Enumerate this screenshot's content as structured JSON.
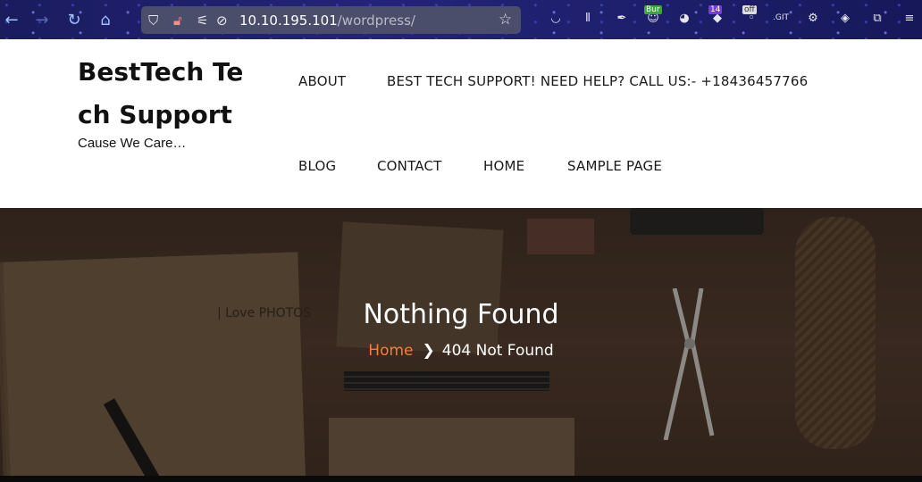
{
  "browser": {
    "url_host": "10.10.195.101",
    "url_path": "/wordpress/",
    "icons": {
      "back": "arrow-left-icon",
      "forward": "arrow-right-icon",
      "reload": "reload-icon",
      "home": "home-icon",
      "shield": "shield-icon",
      "lock": "lock-icon",
      "star": "star-icon"
    },
    "extensions": [
      {
        "name": "pocket-icon",
        "glyph": "◡"
      },
      {
        "name": "library-icon",
        "glyph": "⫴"
      },
      {
        "name": "feather-icon",
        "glyph": "✒"
      },
      {
        "name": "burp-extension-icon",
        "badge": "Bur",
        "glyph": "☺"
      },
      {
        "name": "cookie-icon",
        "glyph": "◕"
      },
      {
        "name": "extension-14-icon",
        "badge": "14",
        "glyph": "◆"
      },
      {
        "name": "extension-off-icon",
        "badge": "off",
        "glyph": "◦"
      },
      {
        "name": "git-extension-icon",
        "glyph": ".GIT"
      },
      {
        "name": "gear-extension-icon",
        "glyph": "⚙"
      },
      {
        "name": "wappalyzer-icon",
        "glyph": "◈"
      },
      {
        "name": "extensions-puzzle-icon",
        "glyph": "⧉"
      },
      {
        "name": "menu-icon",
        "glyph": "≡"
      }
    ]
  },
  "site": {
    "title": "BestTech Tech Support",
    "tagline": "Cause We Care…",
    "nav_row1": [
      "ABOUT",
      "BEST TECH SUPPORT! NEED HELP? CALL US:- +18436457766"
    ],
    "nav_row2": [
      "BLOG",
      "CONTACT",
      "HOME",
      "SAMPLE PAGE"
    ]
  },
  "hero": {
    "title": "Nothing Found",
    "breadcrumb_home": "Home",
    "breadcrumb_separator": "❯",
    "breadcrumb_current": "404 Not Found",
    "accent_color": "#ff7a33",
    "paper_label": "| Love PHOTOS"
  }
}
